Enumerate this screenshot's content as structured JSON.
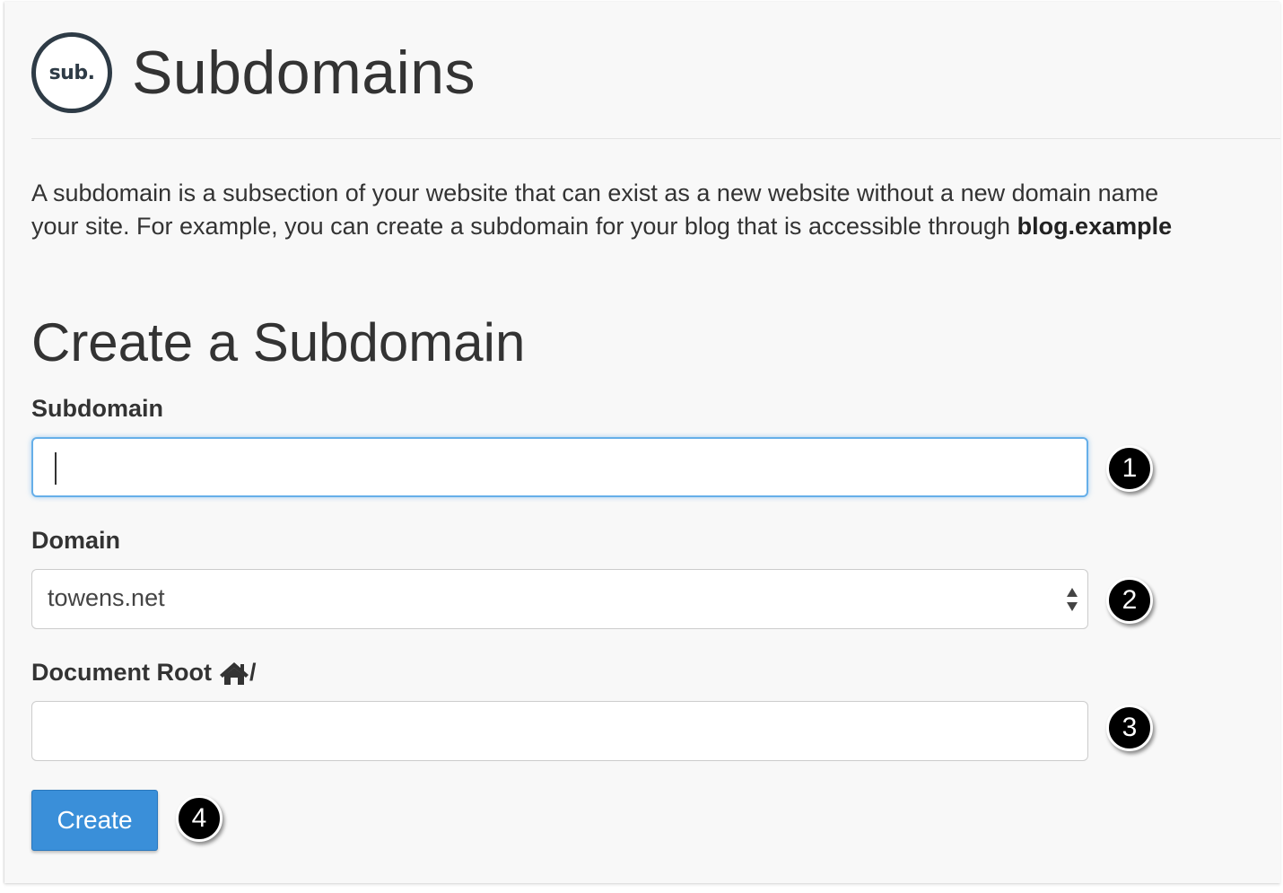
{
  "header": {
    "logo_text": "sub.",
    "title": "Subdomains"
  },
  "description": {
    "line1": "A subdomain is a subsection of your website that can exist as a new website without a new domain name",
    "line2_prefix": "your site. For example, you can create a subdomain for your blog that is accessible through ",
    "line2_bold": "blog.example"
  },
  "form": {
    "section_title": "Create a Subdomain",
    "subdomain_label": "Subdomain",
    "subdomain_value": "",
    "domain_label": "Domain",
    "domain_selected": "towens.net",
    "docroot_label": "Document Root",
    "docroot_suffix": "/",
    "docroot_value": "",
    "create_label": "Create"
  },
  "callouts": [
    "1",
    "2",
    "3",
    "4"
  ],
  "colors": {
    "button_primary": "#3a8fd9",
    "focus_border": "#66afe9",
    "logo_ring": "#2e3b46"
  }
}
